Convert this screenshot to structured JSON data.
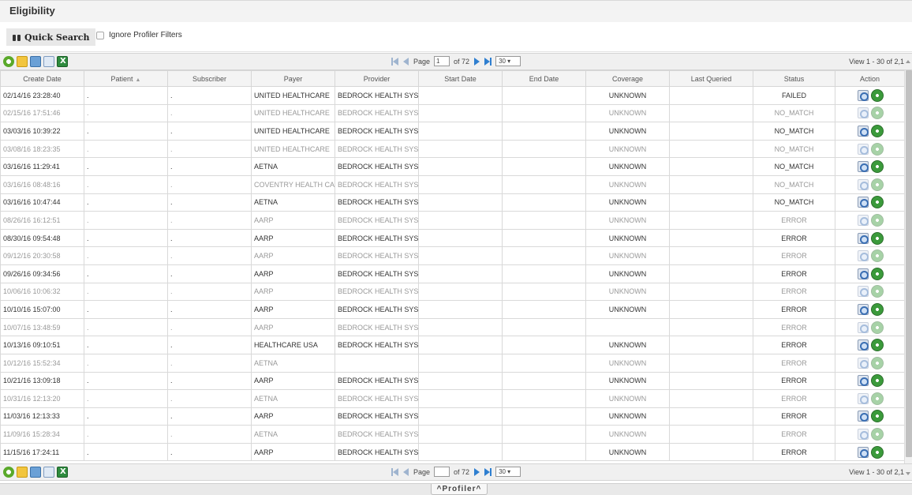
{
  "title": "Eligibility",
  "quick_search": {
    "label": "Quick Search",
    "ignore_profiler_label": "Ignore Profiler Filters"
  },
  "pager": {
    "page_label": "Page",
    "page_value": "1",
    "of_label": "of 72",
    "page_size": "30 ▾",
    "view_info": "View 1 - 30 of 2,1"
  },
  "columns": [
    "Create Date",
    "Patient",
    "Subscriber",
    "Payer",
    "Provider",
    "Start Date",
    "End Date",
    "Coverage",
    "Last Queried",
    "Status",
    "Action"
  ],
  "sort_indicator": "▲",
  "rows": [
    {
      "create_date": "02/14/16 23:28:40",
      "patient": ".",
      "subscriber": ".",
      "payer": "UNITED HEALTHCARE",
      "provider": "BEDROCK HEALTH SYS",
      "coverage": "UNKNOWN",
      "status": "FAILED",
      "dim": false
    },
    {
      "create_date": "02/15/16 17:51:46",
      "patient": ".",
      "subscriber": ".",
      "payer": "UNITED HEALTHCARE",
      "provider": "BEDROCK HEALTH SYS",
      "coverage": "UNKNOWN",
      "status": "NO_MATCH",
      "dim": true
    },
    {
      "create_date": "03/03/16 10:39:22",
      "patient": ".",
      "subscriber": ".",
      "payer": "UNITED HEALTHCARE",
      "provider": "BEDROCK HEALTH SYS",
      "coverage": "UNKNOWN",
      "status": "NO_MATCH",
      "dim": false
    },
    {
      "create_date": "03/08/16 18:23:35",
      "patient": ".",
      "subscriber": ".",
      "payer": "UNITED HEALTHCARE",
      "provider": "BEDROCK HEALTH SYS",
      "coverage": "UNKNOWN",
      "status": "NO_MATCH",
      "dim": true
    },
    {
      "create_date": "03/16/16 11:29:41",
      "patient": ".",
      "subscriber": ".",
      "payer": "AETNA",
      "provider": "BEDROCK HEALTH SYS",
      "coverage": "UNKNOWN",
      "status": "NO_MATCH",
      "dim": false
    },
    {
      "create_date": "03/16/16 08:48:16",
      "patient": ".",
      "subscriber": ".",
      "payer": "COVENTRY HEALTH CA",
      "provider": "BEDROCK HEALTH SYS",
      "coverage": "UNKNOWN",
      "status": "NO_MATCH",
      "dim": true
    },
    {
      "create_date": "03/16/16 10:47:44",
      "patient": ".",
      "subscriber": ".",
      "payer": "AETNA",
      "provider": "BEDROCK HEALTH SYS",
      "coverage": "UNKNOWN",
      "status": "NO_MATCH",
      "dim": false
    },
    {
      "create_date": "08/26/16 16:12:51",
      "patient": ".",
      "subscriber": ".",
      "payer": "AARP",
      "provider": "BEDROCK HEALTH SYS",
      "coverage": "UNKNOWN",
      "status": "ERROR",
      "dim": true
    },
    {
      "create_date": "08/30/16 09:54:48",
      "patient": ".",
      "subscriber": ".",
      "payer": "AARP",
      "provider": "BEDROCK HEALTH SYS",
      "coverage": "UNKNOWN",
      "status": "ERROR",
      "dim": false
    },
    {
      "create_date": "09/12/16 20:30:58",
      "patient": ".",
      "subscriber": ".",
      "payer": "AARP",
      "provider": "BEDROCK HEALTH SYS",
      "coverage": "UNKNOWN",
      "status": "ERROR",
      "dim": true
    },
    {
      "create_date": "09/26/16 09:34:56",
      "patient": ".",
      "subscriber": ".",
      "payer": "AARP",
      "provider": "BEDROCK HEALTH SYS",
      "coverage": "UNKNOWN",
      "status": "ERROR",
      "dim": false
    },
    {
      "create_date": "10/06/16 10:06:32",
      "patient": ".",
      "subscriber": ".",
      "payer": "AARP",
      "provider": "BEDROCK HEALTH SYS",
      "coverage": "UNKNOWN",
      "status": "ERROR",
      "dim": true
    },
    {
      "create_date": "10/10/16 15:07:00",
      "patient": ".",
      "subscriber": ".",
      "payer": "AARP",
      "provider": "BEDROCK HEALTH SYS",
      "coverage": "UNKNOWN",
      "status": "ERROR",
      "dim": false
    },
    {
      "create_date": "10/07/16 13:48:59",
      "patient": ".",
      "subscriber": ".",
      "payer": "AARP",
      "provider": "BEDROCK HEALTH SYS",
      "coverage": "",
      "status": "ERROR",
      "dim": true
    },
    {
      "create_date": "10/13/16 09:10:51",
      "patient": ".",
      "subscriber": ".",
      "payer": "HEALTHCARE USA",
      "provider": "BEDROCK HEALTH SYS",
      "coverage": "UNKNOWN",
      "status": "ERROR",
      "dim": false
    },
    {
      "create_date": "10/12/16 15:52:34",
      "patient": ".",
      "subscriber": ".",
      "payer": "AETNA",
      "provider": "",
      "coverage": "UNKNOWN",
      "status": "ERROR",
      "dim": true
    },
    {
      "create_date": "10/21/16 13:09:18",
      "patient": ".",
      "subscriber": ".",
      "payer": "AARP",
      "provider": "BEDROCK HEALTH SYS",
      "coverage": "UNKNOWN",
      "status": "ERROR",
      "dim": false
    },
    {
      "create_date": "10/31/16 12:13:20",
      "patient": ".",
      "subscriber": ".",
      "payer": "AETNA",
      "provider": "BEDROCK HEALTH SYS",
      "coverage": "UNKNOWN",
      "status": "ERROR",
      "dim": true
    },
    {
      "create_date": "11/03/16 12:13:33",
      "patient": ".",
      "subscriber": ".",
      "payer": "AARP",
      "provider": "BEDROCK HEALTH SYS",
      "coverage": "UNKNOWN",
      "status": "ERROR",
      "dim": false
    },
    {
      "create_date": "11/09/16 15:28:34",
      "patient": ".",
      "subscriber": ".",
      "payer": "AETNA",
      "provider": "BEDROCK HEALTH SYS",
      "coverage": "UNKNOWN",
      "status": "ERROR",
      "dim": true
    },
    {
      "create_date": "11/15/16 17:24:11",
      "patient": ".",
      "subscriber": ".",
      "payer": "AARP",
      "provider": "BEDROCK HEALTH SYS",
      "coverage": "UNKNOWN",
      "status": "ERROR",
      "dim": false
    }
  ],
  "icons": {
    "toolbar": [
      "refresh-icon",
      "notes-icon",
      "copy-icon",
      "page-icon",
      "excel-export-icon"
    ],
    "row_actions": [
      "view-details-icon",
      "rerun-icon"
    ]
  },
  "profiler": {
    "label": "^Profiler^"
  }
}
